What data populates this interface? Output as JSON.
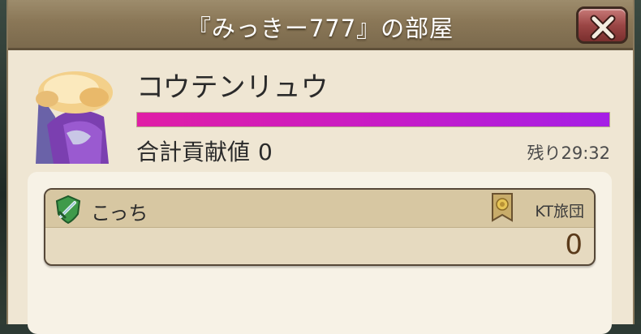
{
  "title": "『みっきー777』の部屋",
  "close_icon": "close-x-icon",
  "boss": {
    "name": "コウテンリュウ",
    "hp_fraction": 1.0,
    "hp_colors": [
      "#e01ea6",
      "#a51ee6"
    ]
  },
  "contribution": {
    "label": "合計貢献値",
    "value": "0"
  },
  "remaining_time": "残り29:32",
  "participants": [
    {
      "name": "こっち",
      "role_icon": "sword-shield-icon",
      "guild_icon": "guild-emblem-icon",
      "guild": "KT旅団",
      "score": "0"
    }
  ]
}
